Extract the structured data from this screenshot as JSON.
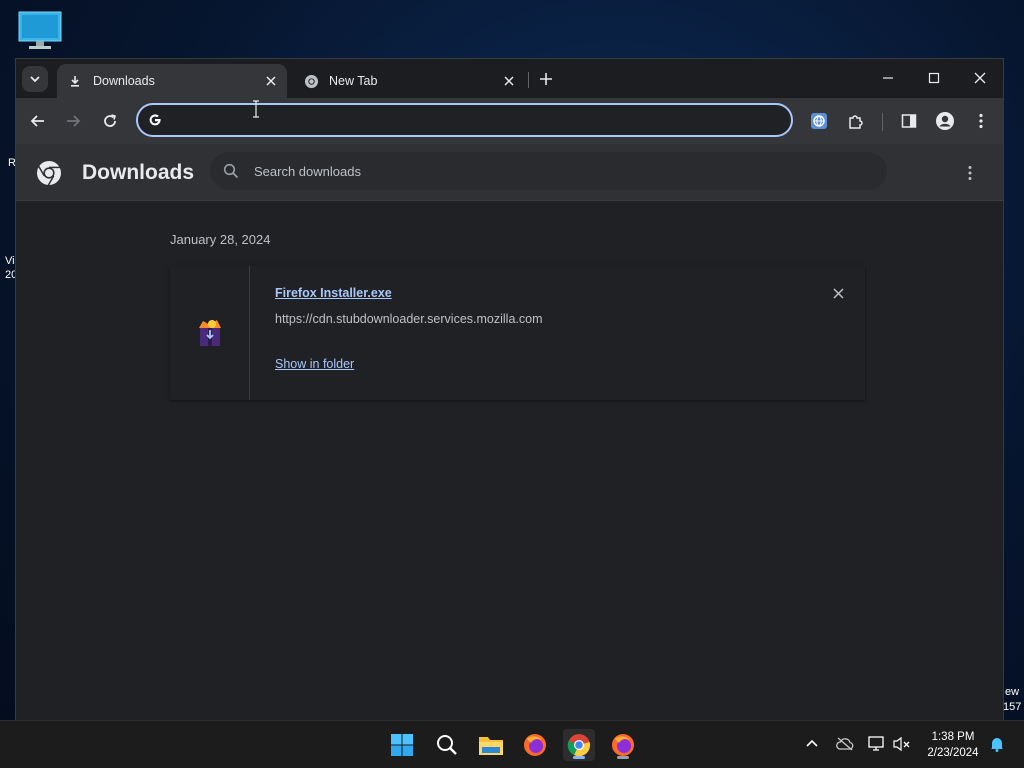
{
  "desktop": {
    "edge_text_left": [
      "R",
      "Vi",
      "20"
    ],
    "edge_text_right": [
      "ew",
      "157"
    ]
  },
  "browser": {
    "tabs": [
      {
        "title": "Downloads",
        "active": true,
        "icon": "download-icon"
      },
      {
        "title": "New Tab",
        "active": false,
        "icon": "chrome-icon"
      }
    ],
    "omnibox": {
      "value": "",
      "placeholder": ""
    },
    "window_controls": [
      "minimize",
      "maximize",
      "close"
    ]
  },
  "downloads_page": {
    "title": "Downloads",
    "search_placeholder": "Search downloads",
    "groups": [
      {
        "date": "January 28, 2024",
        "items": [
          {
            "file_name": "Firefox Installer.exe",
            "url": "https://cdn.stubdownloader.services.mozilla.com",
            "action_label": "Show in folder"
          }
        ]
      }
    ]
  },
  "taskbar": {
    "apps": [
      "windows-start",
      "search",
      "file-explorer",
      "firefox",
      "chrome",
      "firefox-installer"
    ],
    "clock": {
      "time": "1:38 PM",
      "date": "2/23/2024"
    }
  },
  "colors": {
    "accent": "#a8c7fa",
    "window_bg": "#202124",
    "toolbar_bg": "#35363a"
  }
}
